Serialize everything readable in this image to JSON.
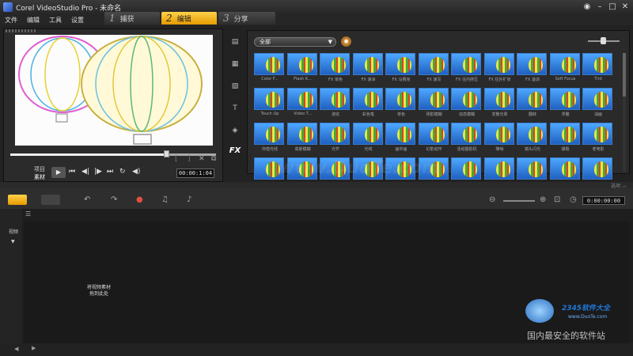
{
  "window": {
    "title": "Corel VideoStudio Pro - 未命名"
  },
  "menu": [
    "文件",
    "编辑",
    "工具",
    "设置"
  ],
  "steps": [
    {
      "num": "1",
      "label": "捕获"
    },
    {
      "num": "2",
      "label": "编辑"
    },
    {
      "num": "3",
      "label": "分享"
    }
  ],
  "preview": {
    "mode_project": "项目",
    "mode_clip": "素材",
    "timecode": "00:00:1:04",
    "play": "▶"
  },
  "library": {
    "category": "全部",
    "items": [
      {
        "label": "Color F..."
      },
      {
        "label": "Flash K..."
      },
      {
        "label": "FX 单色"
      },
      {
        "label": "FX 速涂"
      },
      {
        "label": "FX 马赛克"
      },
      {
        "label": "FX 速写"
      },
      {
        "label": "FX 往内挤压"
      },
      {
        "label": "FX 往外扩张"
      },
      {
        "label": "FX 漩涡"
      },
      {
        "label": "Soft Focus"
      },
      {
        "label": "Tint"
      },
      {
        "label": "Touch Up"
      },
      {
        "label": "Video T..."
      },
      {
        "label": "波纹"
      },
      {
        "label": "彩色笔"
      },
      {
        "label": "单色"
      },
      {
        "label": "残影模糊"
      },
      {
        "label": "动态模糊"
      },
      {
        "label": "发散光晕"
      },
      {
        "label": "翻转"
      },
      {
        "label": "浮雕"
      },
      {
        "label": "油画"
      },
      {
        "label": "你借光线"
      },
      {
        "label": "高斯模糊"
      },
      {
        "label": "光芒"
      },
      {
        "label": "光线"
      },
      {
        "label": "画中画"
      },
      {
        "label": "幻影动作"
      },
      {
        "label": "活动摄影机"
      },
      {
        "label": "降噪"
      },
      {
        "label": "镜头闪光"
      },
      {
        "label": "爆裂"
      },
      {
        "label": "老电影"
      },
      {
        "label": ""
      },
      {
        "label": ""
      },
      {
        "label": ""
      },
      {
        "label": ""
      },
      {
        "label": ""
      },
      {
        "label": ""
      },
      {
        "label": ""
      },
      {
        "label": ""
      },
      {
        "label": ""
      },
      {
        "label": ""
      },
      {
        "label": ""
      }
    ]
  },
  "strip": {
    "right": "选项  ︿"
  },
  "timeline": {
    "track_label": "视频",
    "timecode": "0:00:00:00",
    "drop_hint": "将视频素材拖到此处"
  },
  "watermark": "www.DuoTe.com",
  "logo": {
    "brand": "2345软件大全",
    "url": "www.DuoTe.com",
    "slogan": "国内最安全的软件站"
  }
}
